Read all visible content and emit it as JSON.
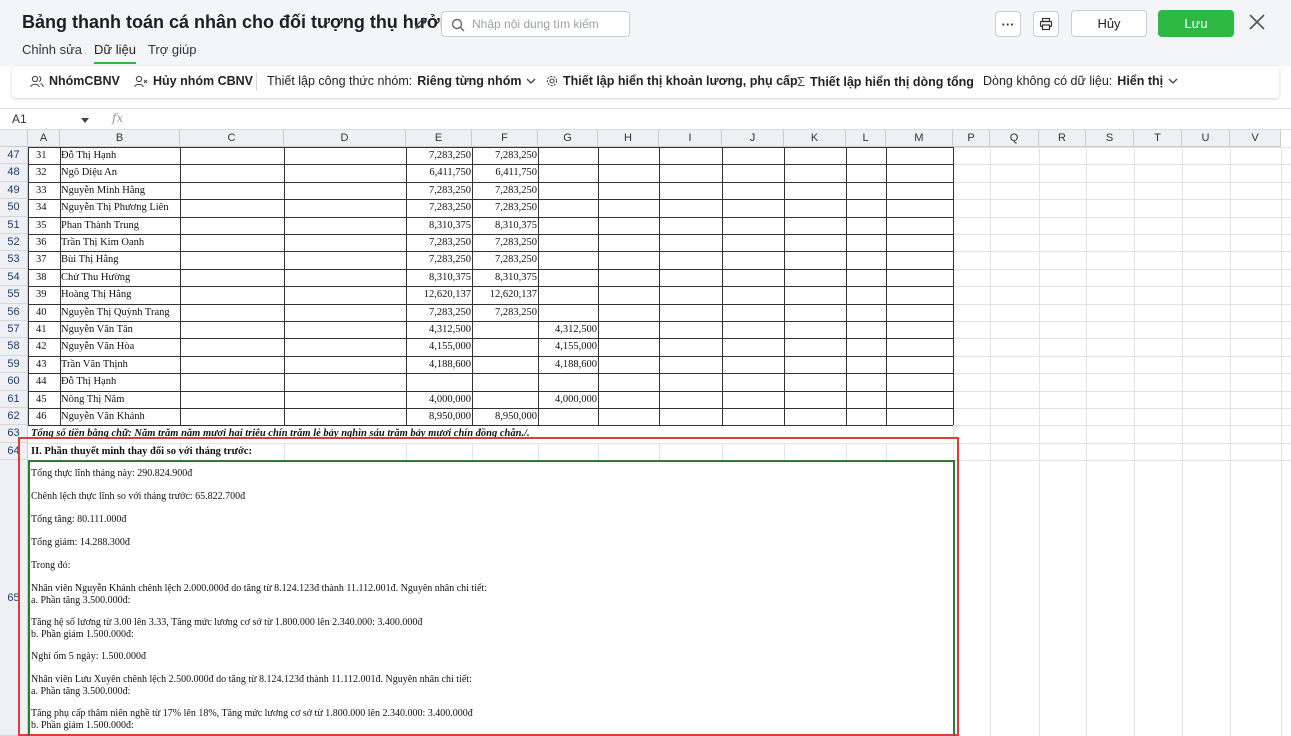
{
  "header": {
    "title": "Bảng thanh toán cá nhân cho đối tượng thụ hưởng",
    "search_placeholder": "Nhập nội dung tìm kiếm",
    "cancel_label": "Hủy",
    "save_label": "Lưu",
    "more_label": "···"
  },
  "tabs": [
    {
      "label": "Chỉnh sửa"
    },
    {
      "label": "Dữ liệu"
    },
    {
      "label": "Trợ giúp"
    }
  ],
  "ribbon": {
    "group": "NhómCBNV",
    "ungroup": "Hủy nhóm CBNV",
    "formula_label": "Thiết lập công thức nhóm:",
    "formula_value": "Riêng từng nhóm",
    "display_allowance": "Thiết lập hiển thị khoản lương, phụ cấp",
    "display_total": "Thiết lập hiển thị dòng tổng",
    "empty_rows_label": "Dòng không có dữ liệu:",
    "empty_rows_value": "Hiển thị"
  },
  "formula_bar": {
    "cell_ref": "A1",
    "fx": "fx"
  },
  "columns": [
    "A",
    "B",
    "C",
    "D",
    "E",
    "F",
    "G",
    "H",
    "I",
    "J",
    "K",
    "L",
    "M",
    "P",
    "Q",
    "R",
    "S",
    "T",
    "U",
    "V"
  ],
  "rows": [
    {
      "row": "47",
      "a": "31",
      "b": "Đỗ Thị Hạnh",
      "e": "7,283,250",
      "f": "7,283,250",
      "g": ""
    },
    {
      "row": "48",
      "a": "32",
      "b": "Ngô Diệu An",
      "e": "6,411,750",
      "f": "6,411,750",
      "g": ""
    },
    {
      "row": "49",
      "a": "33",
      "b": "Nguyễn Minh Hằng",
      "e": "7,283,250",
      "f": "7,283,250",
      "g": ""
    },
    {
      "row": "50",
      "a": "34",
      "b": "Nguyễn Thị Phương Liên",
      "e": "7,283,250",
      "f": "7,283,250",
      "g": ""
    },
    {
      "row": "51",
      "a": "35",
      "b": "Phan Thành Trung",
      "e": "8,310,375",
      "f": "8,310,375",
      "g": ""
    },
    {
      "row": "52",
      "a": "36",
      "b": "Trần Thị Kim Oanh",
      "e": "7,283,250",
      "f": "7,283,250",
      "g": ""
    },
    {
      "row": "53",
      "a": "37",
      "b": "Bùi Thị Hằng",
      "e": "7,283,250",
      "f": "7,283,250",
      "g": ""
    },
    {
      "row": "54",
      "a": "38",
      "b": "Chử Thu Hường",
      "e": "8,310,375",
      "f": "8,310,375",
      "g": ""
    },
    {
      "row": "55",
      "a": "39",
      "b": "Hoàng Thị Hằng",
      "e": "12,620,137",
      "f": "12,620,137",
      "g": ""
    },
    {
      "row": "56",
      "a": "40",
      "b": "Nguyễn Thị Quỳnh Trang",
      "e": "7,283,250",
      "f": "7,283,250",
      "g": ""
    },
    {
      "row": "57",
      "a": "41",
      "b": "Nguyễn Văn Tân",
      "e": "4,312,500",
      "f": "",
      "g": "4,312,500"
    },
    {
      "row": "58",
      "a": "42",
      "b": "Nguyễn Văn Hòa",
      "e": "4,155,000",
      "f": "",
      "g": "4,155,000"
    },
    {
      "row": "59",
      "a": "43",
      "b": "Trần Văn Thịnh",
      "e": "4,188,600",
      "f": "",
      "g": "4,188,600"
    },
    {
      "row": "60",
      "a": "44",
      "b": "Đỗ Thị Hạnh",
      "e": "",
      "f": "",
      "g": ""
    },
    {
      "row": "61",
      "a": "45",
      "b": "Nông Thị Năm",
      "e": "4,000,000",
      "f": "",
      "g": "4,000,000"
    },
    {
      "row": "62",
      "a": "46",
      "b": "Nguyễn Văn Khánh",
      "e": "8,950,000",
      "f": "8,950,000",
      "g": ""
    }
  ],
  "row63": {
    "row": "63",
    "text": "Tổng số tiền bằng chữ: Năm trăm năm mươi hai triệu chín trăm lẻ bảy nghìn sáu trăm bảy mươi chín đồng chẵn./."
  },
  "row64": {
    "row": "64",
    "text": "II. Phần thuyết minh thay đổi so với tháng trước:"
  },
  "row65": {
    "row": "65"
  },
  "notes": [
    "Tổng thực lĩnh tháng này: 290.824.900đ",
    "Chênh lệch thực lĩnh so với tháng trước: 65.822.700đ",
    "Tổng tăng: 80.111.000đ",
    "Tổng giảm: 14.288.300đ",
    "Trong đó:",
    "Nhân viên Nguyễn Khánh chênh lệch 2.000.000đ do tăng từ 8.124.123đ thành 11.112.001đ. Nguyên nhân chi tiết:",
    "a. Phần tăng 3.500.000đ:",
    "Tăng hệ số lương từ 3.00 lên 3.33, Tăng mức lương cơ sở từ 1.800.000 lên 2.340.000: 3.400.000đ",
    "b. Phần giảm 1.500.000đ:",
    "Nghỉ ốm 5 ngày: 1.500.000đ",
    "Nhân viên Lưu Xuyên chênh lệch 2.500.000đ do tăng từ 8.124.123đ thành 11.112.001đ. Nguyên nhân chi tiết:",
    "a. Phần tăng 3.500.000đ:",
    "Tăng phụ cấp thâm niên nghề từ 17% lên 18%, Tăng mức lương cơ sở từ 1.800.000 lên 2.340.000: 3.400.000đ",
    "b. Phần giảm 1.500.000đ:"
  ]
}
